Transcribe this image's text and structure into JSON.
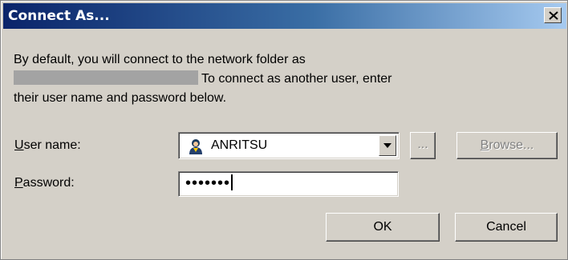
{
  "window": {
    "title": "Connect As..."
  },
  "message": {
    "line1": "By default, you will connect to the network folder as",
    "line2": "To connect as another user, enter",
    "line3": "their user name and password below."
  },
  "username": {
    "label_accel": "U",
    "label_rest": "ser name:",
    "value": "ANRITSU",
    "icon": "user-icon"
  },
  "password": {
    "label_accel": "P",
    "label_rest": "assword:",
    "masked_value": "•••••••"
  },
  "buttons": {
    "dots": "...",
    "browse_accel": "B",
    "browse_rest": "rowse...",
    "ok": "OK",
    "cancel": "Cancel"
  },
  "colors": {
    "title_gradient_start": "#0a246a",
    "title_gradient_end": "#a6caf0",
    "dialog_face": "#d4d0c8"
  }
}
